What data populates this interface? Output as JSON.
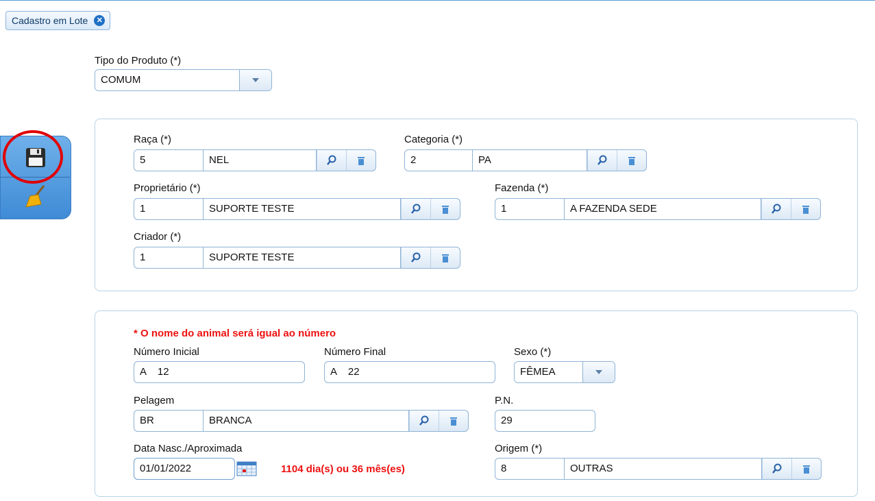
{
  "tab": {
    "label": "Cadastro em Lote"
  },
  "sidebar": {
    "save_icon": "floppy-disk-icon",
    "clear_icon": "broom-icon"
  },
  "tipo_produto": {
    "label": "Tipo do Produto (*)",
    "value": "COMUM"
  },
  "animal_box": {
    "raca": {
      "label": "Raça (*)",
      "code": "5",
      "desc": "NEL"
    },
    "categoria": {
      "label": "Categoria (*)",
      "code": "2",
      "desc": "PA"
    },
    "proprietario": {
      "label": "Proprietário (*)",
      "code": "1",
      "desc": "SUPORTE TESTE"
    },
    "fazenda": {
      "label": "Fazenda (*)",
      "code": "1",
      "desc": "A FAZENDA SEDE"
    },
    "criador": {
      "label": "Criador (*)",
      "code": "1",
      "desc": "SUPORTE TESTE"
    }
  },
  "detail_box": {
    "notice": "* O nome do animal será igual ao número",
    "numero_inicial": {
      "label": "Número Inicial",
      "value": "A    12"
    },
    "numero_final": {
      "label": "Número Final",
      "value": "A    22"
    },
    "sexo": {
      "label": "Sexo (*)",
      "value": "FÊMEA"
    },
    "pelagem": {
      "label": "Pelagem",
      "code": "BR",
      "desc": "BRANCA"
    },
    "pn": {
      "label": "P.N.",
      "value": "29"
    },
    "data_nasc": {
      "label": "Data Nasc./Aproximada",
      "value": "01/01/2022",
      "age_text": "1104 dia(s) ou 36 mês(es)"
    },
    "origem": {
      "label": "Origem (*)",
      "code": "8",
      "desc": "OUTRAS"
    }
  },
  "colors": {
    "accent": "#5b9bd5",
    "highlight_circle": "#e00000",
    "warning_text": "#ee1111"
  }
}
